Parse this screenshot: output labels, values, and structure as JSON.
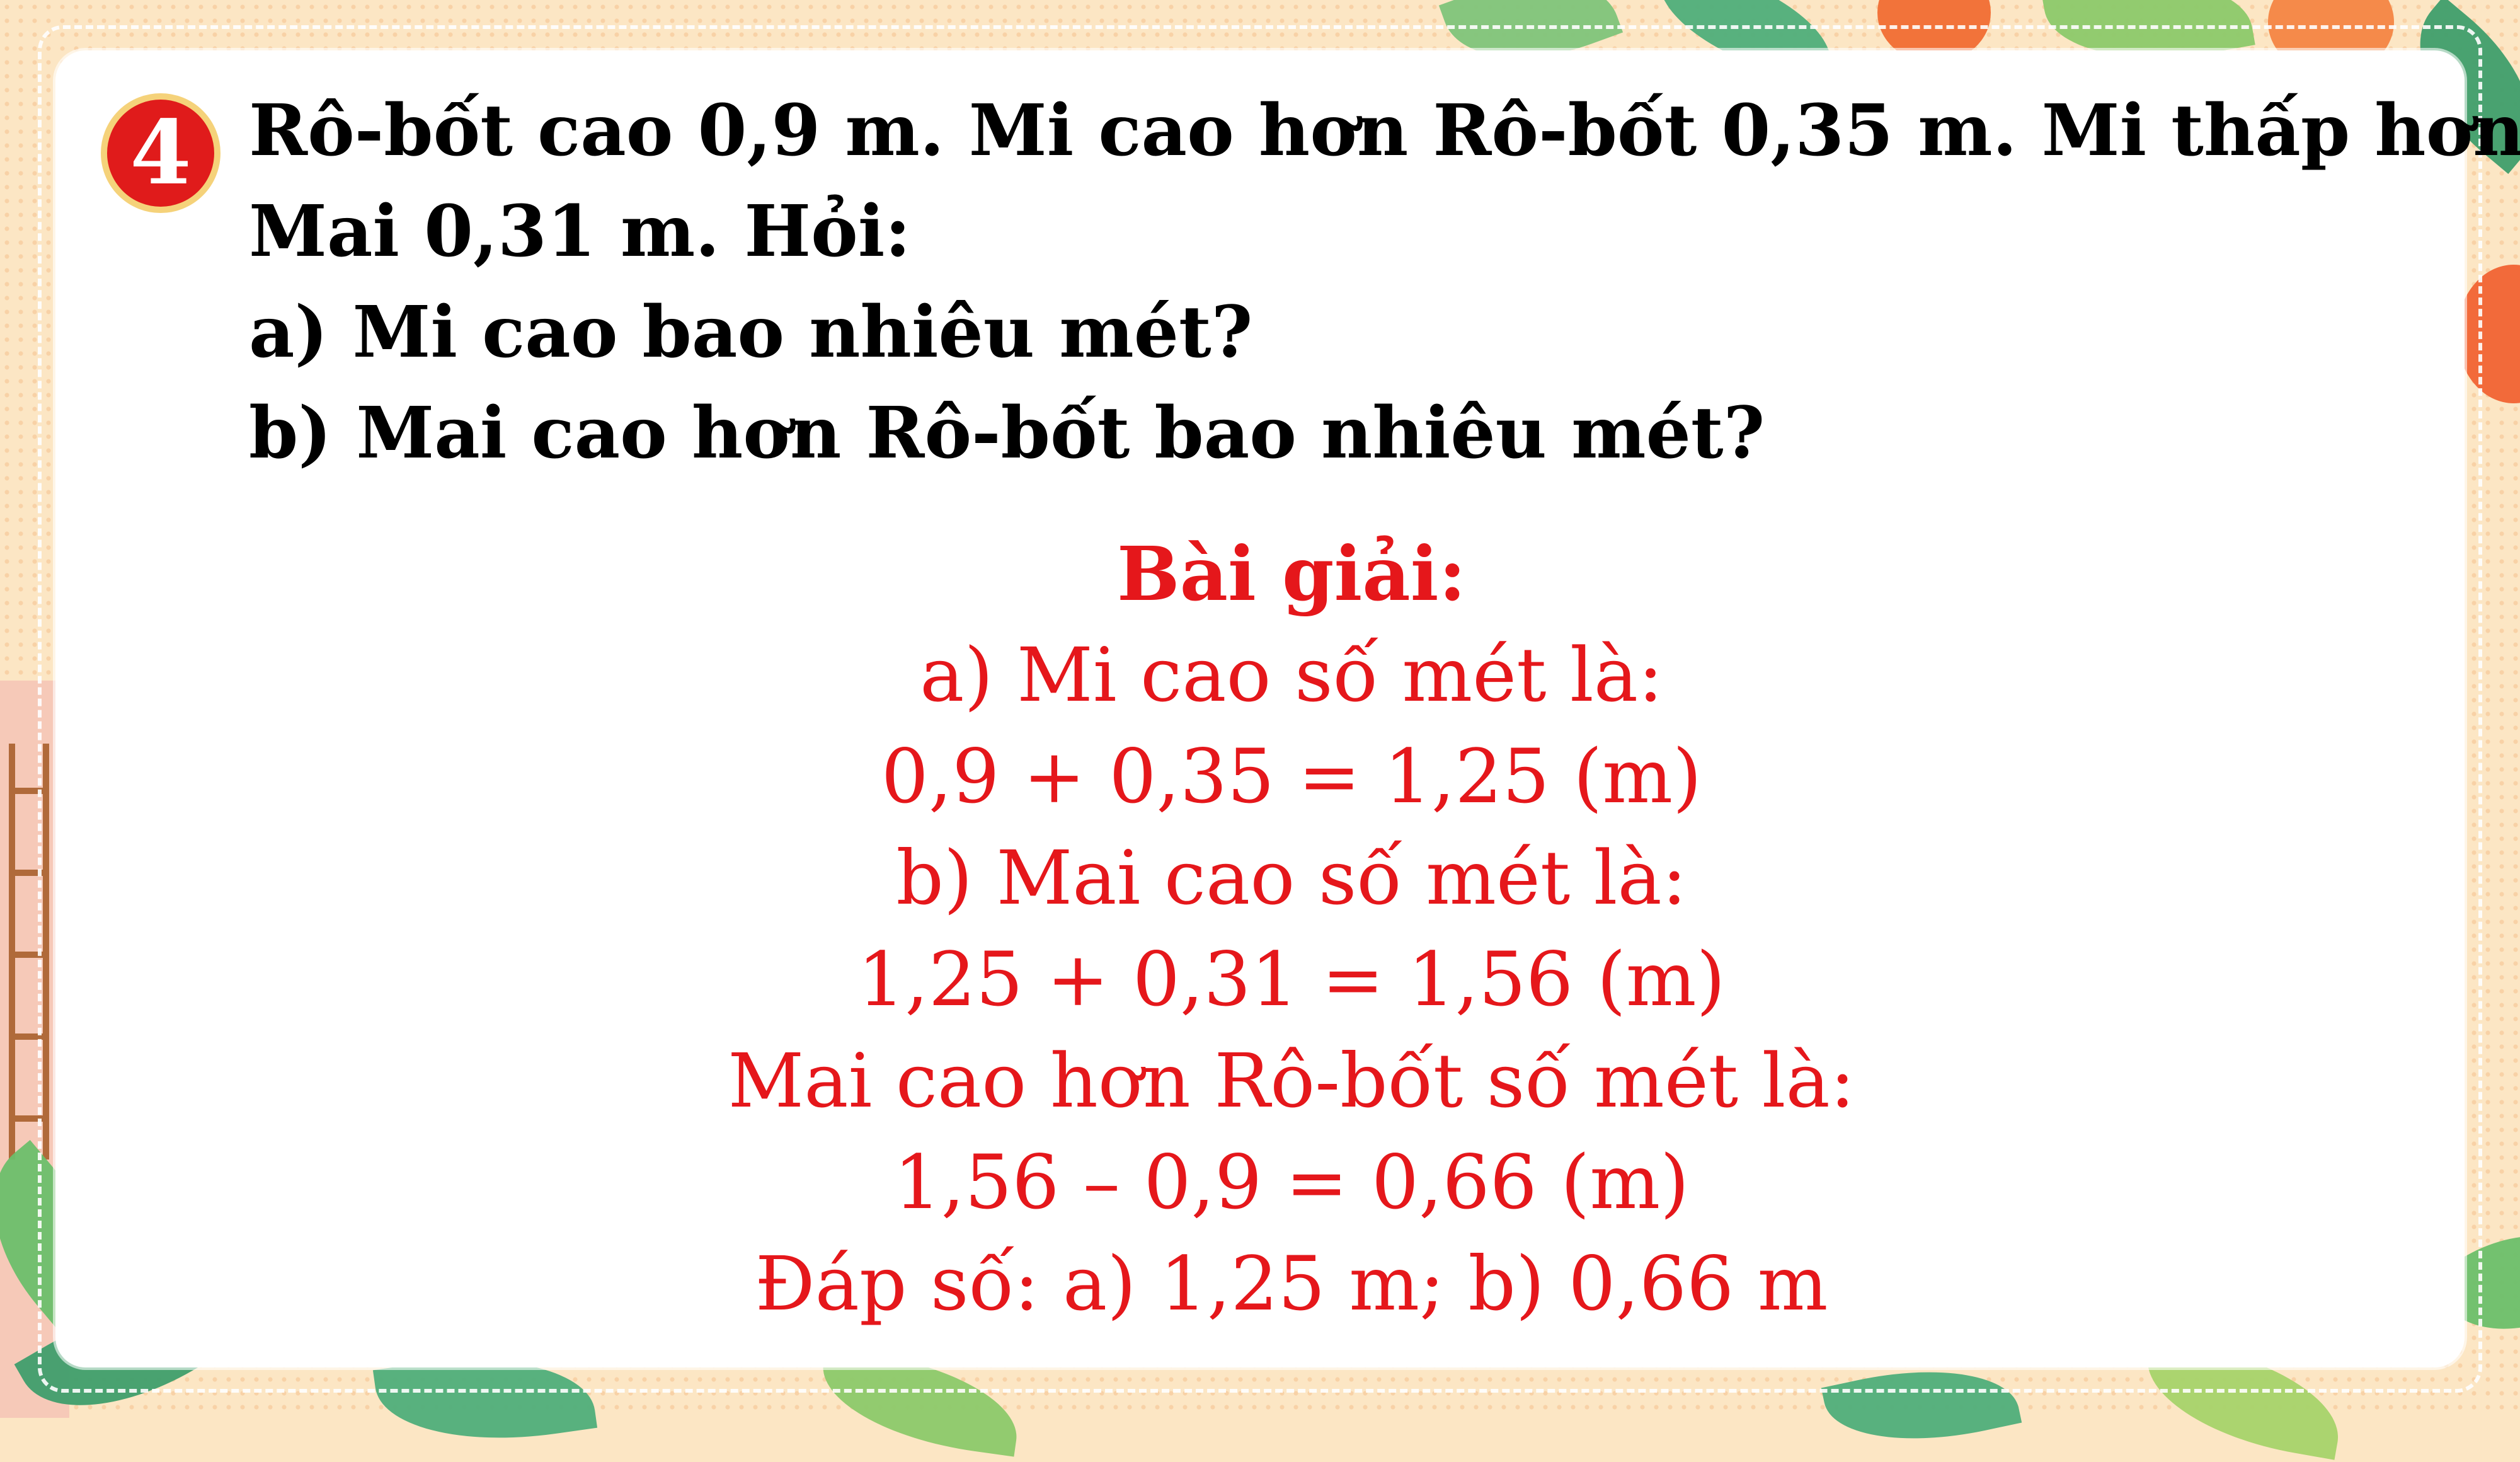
{
  "badge": {
    "number": "4"
  },
  "question": {
    "lines": [
      "Rô-bốt cao 0,9 m. Mi cao hơn Rô-bốt 0,35 m. Mi thấp hơn",
      "Mai 0,31 m. Hỏi:",
      "a) Mi cao bao nhiêu mét?",
      "b) Mai cao hơn Rô-bốt bao nhiêu mét?"
    ]
  },
  "solution": {
    "title": "Bài giải:",
    "lines": [
      "a) Mi cao số mét là:",
      "0,9 + 0,35 = 1,25 (m)",
      "b) Mai cao số mét là:",
      "1,25 + 0,31 = 1,56 (m)",
      "Mai cao hơn Rô-bốt số mét là:",
      "1,56 – 0,9 = 0,66 (m)",
      "Đáp số: a) 1,25 m; b) 0,66 m"
    ]
  },
  "colors": {
    "background": "#fce6c4",
    "badge": "#e01b1b",
    "question_text": "#000000",
    "solution_text": "#e5171b"
  }
}
